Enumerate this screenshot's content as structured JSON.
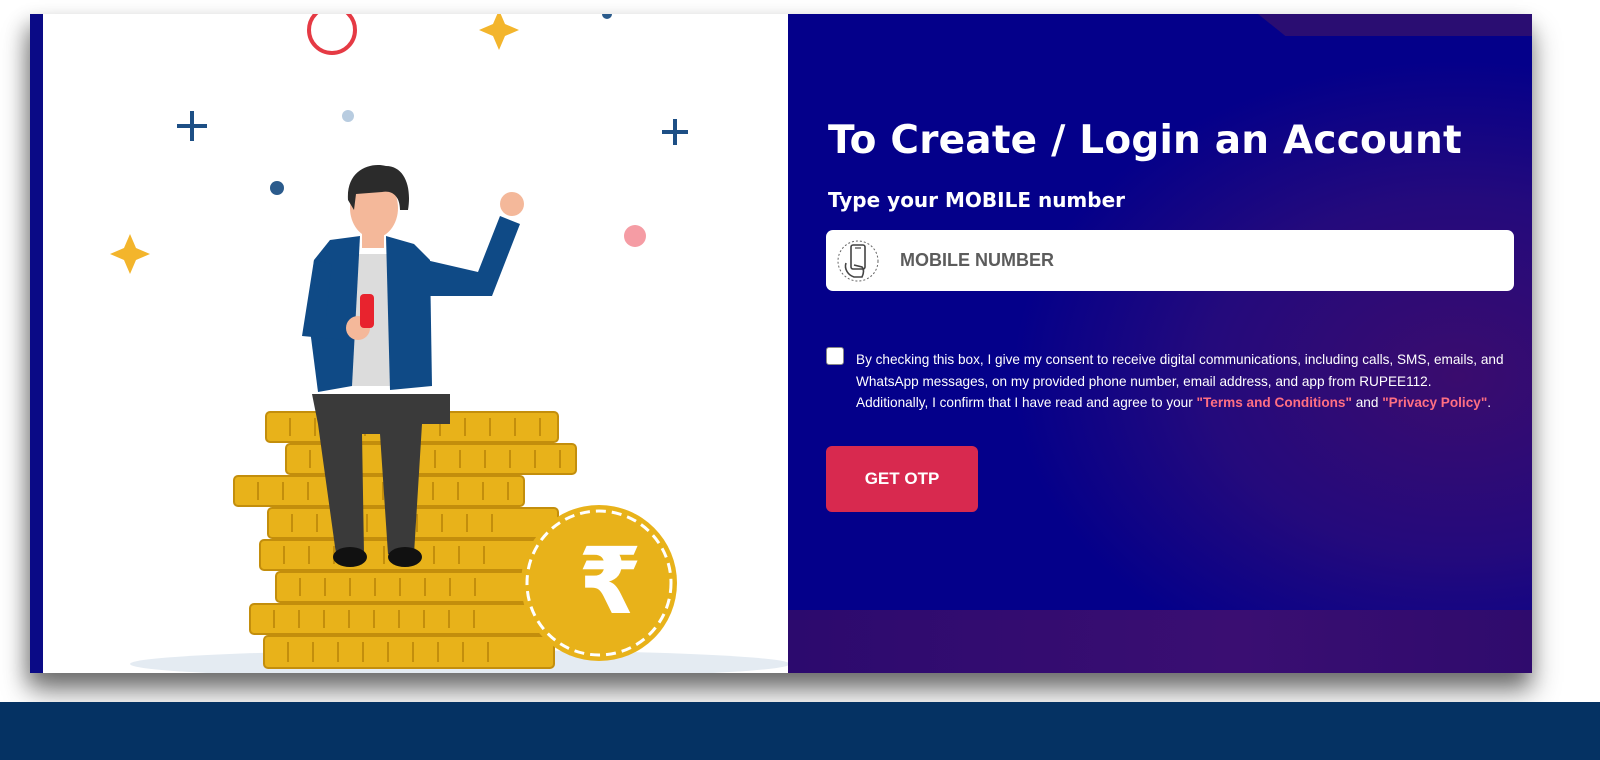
{
  "login": {
    "title": "To Create / Login an Account",
    "subtitle": "Type your MOBILE number",
    "mobile_placeholder": "MOBILE NUMBER",
    "consent": {
      "checked": false,
      "text_line1": "By checking this box, I give my consent to receive digital communications, including calls, SMS, emails, and WhatsApp messages, on my provided phone number, email address, and app from RUPEE112.",
      "text_line2": "Additionally, I confirm that I have read and agree to your",
      "terms_link": "\"Terms and Conditions\"",
      "and_text": "and",
      "privacy_link": "\"Privacy Policy\"",
      "period": "."
    },
    "otp_button": "GET OTP"
  },
  "illustration": {
    "currency_symbol": "₹"
  },
  "colors": {
    "panel_blue": "#04008a",
    "panel_purple": "#3a0c6e",
    "button": "#d8294f",
    "link": "#ff6f82",
    "footer": "#053263",
    "coin_gold": "#e8b21a"
  }
}
